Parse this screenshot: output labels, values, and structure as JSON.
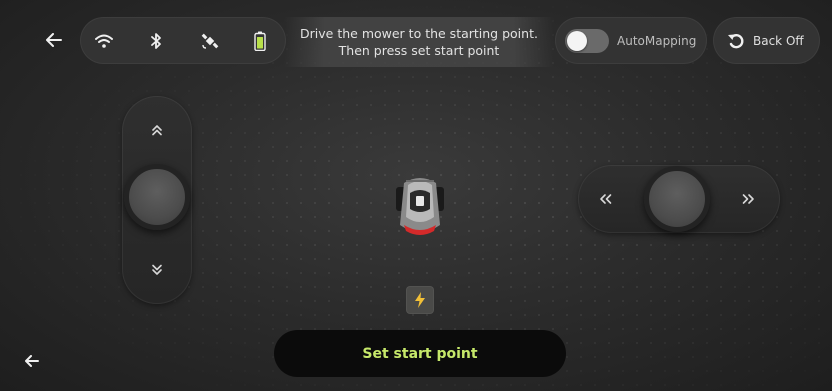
{
  "header": {
    "hint_line1": "Drive the mower to the starting point.",
    "hint_line2": "Then press set start point",
    "automapping_label": "AutoMapping",
    "automapping_on": false,
    "backoff_label": "Back Off"
  },
  "status_icons": [
    "wifi-icon",
    "bluetooth-icon",
    "satellite-icon",
    "battery-icon"
  ],
  "controls": {
    "vertical_joystick": {
      "up_icon": "chevron-double-up-icon",
      "down_icon": "chevron-double-down-icon"
    },
    "horizontal_joystick": {
      "left_icon": "chevron-double-left-icon",
      "right_icon": "chevron-double-right-icon"
    }
  },
  "footer": {
    "set_start_label": "Set start point"
  },
  "colors": {
    "accent": "#c6e86a",
    "battery": "#b8e04a",
    "charge_bolt": "#f2c037",
    "mower_red": "#d42a2a"
  }
}
